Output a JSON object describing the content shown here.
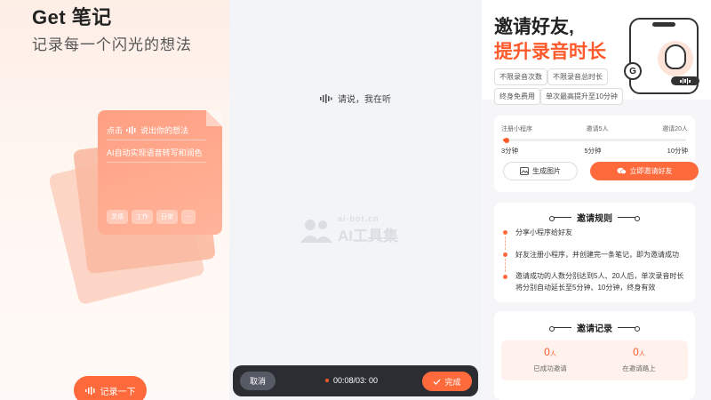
{
  "left": {
    "logo": "Get 笔记",
    "tagline": "记录每一个闪光的想法",
    "note": {
      "prefix": "点击",
      "action": "说出你的想法",
      "subtitle": "AI自动实现语音转写和润色",
      "tags": [
        "灵感",
        "工作",
        "日常",
        "..."
      ]
    },
    "record_button": "记录一下"
  },
  "middle": {
    "listening_text": "请说，我在听",
    "watermark": {
      "line1": "ai-bot.cn",
      "line2": "AI工具集"
    },
    "recorder": {
      "cancel_label": "取消",
      "timer": "00:08/03: 00",
      "done_label": "完成"
    }
  },
  "right": {
    "title_line1": "邀请好友,",
    "title_line2": "提升录音时长",
    "chips": [
      "不限录音次数",
      "不限录音总时长",
      "终身免费用",
      "单次最高提升至10分钟"
    ],
    "progress": {
      "levels": [
        "注册小程序",
        "邀请5人",
        "邀请20人"
      ],
      "durations": [
        "3分钟",
        "5分钟",
        "10分钟"
      ],
      "fill_fraction": 0.0
    },
    "buttons": {
      "generate_image": "生成图片",
      "invite_now": "立即邀请好友"
    },
    "rules": {
      "title": "邀请规则",
      "items": [
        "分享小程序给好友",
        "好友注册小程序，并创建完一条笔记，即为邀请成功",
        "邀请成功的人数分别达到5人、20人后，单次录音时长将分别自动延长至5分钟、10分钟，终身有效"
      ]
    },
    "records": {
      "title": "邀请记录",
      "stats": [
        {
          "value": "0",
          "unit": "人",
          "label": "已成功邀请"
        },
        {
          "value": "0",
          "unit": "人",
          "label": "在邀请路上"
        }
      ]
    },
    "colors": {
      "accent": "#ff5a2c",
      "accent_button": "#ff6a3d"
    }
  }
}
